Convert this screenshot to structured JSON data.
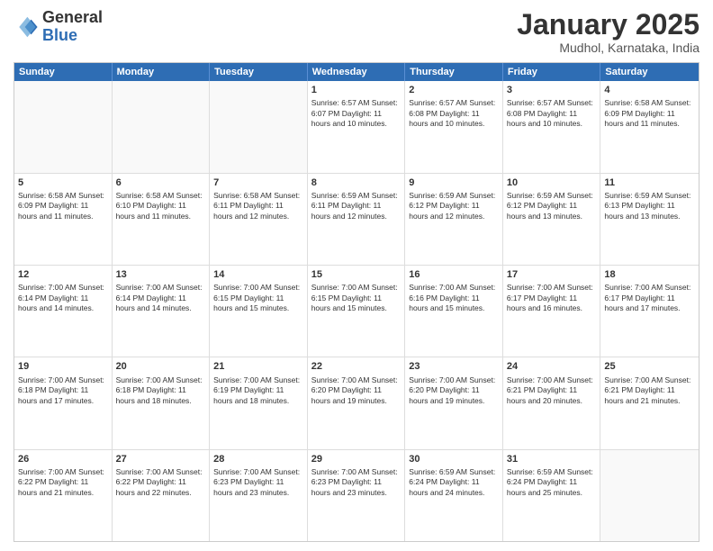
{
  "header": {
    "logo": {
      "general": "General",
      "blue": "Blue"
    },
    "title": "January 2025",
    "subtitle": "Mudhol, Karnataka, India"
  },
  "days_of_week": [
    "Sunday",
    "Monday",
    "Tuesday",
    "Wednesday",
    "Thursday",
    "Friday",
    "Saturday"
  ],
  "weeks": [
    [
      {
        "day": "",
        "info": ""
      },
      {
        "day": "",
        "info": ""
      },
      {
        "day": "",
        "info": ""
      },
      {
        "day": "1",
        "info": "Sunrise: 6:57 AM\nSunset: 6:07 PM\nDaylight: 11 hours\nand 10 minutes."
      },
      {
        "day": "2",
        "info": "Sunrise: 6:57 AM\nSunset: 6:08 PM\nDaylight: 11 hours\nand 10 minutes."
      },
      {
        "day": "3",
        "info": "Sunrise: 6:57 AM\nSunset: 6:08 PM\nDaylight: 11 hours\nand 10 minutes."
      },
      {
        "day": "4",
        "info": "Sunrise: 6:58 AM\nSunset: 6:09 PM\nDaylight: 11 hours\nand 11 minutes."
      }
    ],
    [
      {
        "day": "5",
        "info": "Sunrise: 6:58 AM\nSunset: 6:09 PM\nDaylight: 11 hours\nand 11 minutes."
      },
      {
        "day": "6",
        "info": "Sunrise: 6:58 AM\nSunset: 6:10 PM\nDaylight: 11 hours\nand 11 minutes."
      },
      {
        "day": "7",
        "info": "Sunrise: 6:58 AM\nSunset: 6:11 PM\nDaylight: 11 hours\nand 12 minutes."
      },
      {
        "day": "8",
        "info": "Sunrise: 6:59 AM\nSunset: 6:11 PM\nDaylight: 11 hours\nand 12 minutes."
      },
      {
        "day": "9",
        "info": "Sunrise: 6:59 AM\nSunset: 6:12 PM\nDaylight: 11 hours\nand 12 minutes."
      },
      {
        "day": "10",
        "info": "Sunrise: 6:59 AM\nSunset: 6:12 PM\nDaylight: 11 hours\nand 13 minutes."
      },
      {
        "day": "11",
        "info": "Sunrise: 6:59 AM\nSunset: 6:13 PM\nDaylight: 11 hours\nand 13 minutes."
      }
    ],
    [
      {
        "day": "12",
        "info": "Sunrise: 7:00 AM\nSunset: 6:14 PM\nDaylight: 11 hours\nand 14 minutes."
      },
      {
        "day": "13",
        "info": "Sunrise: 7:00 AM\nSunset: 6:14 PM\nDaylight: 11 hours\nand 14 minutes."
      },
      {
        "day": "14",
        "info": "Sunrise: 7:00 AM\nSunset: 6:15 PM\nDaylight: 11 hours\nand 15 minutes."
      },
      {
        "day": "15",
        "info": "Sunrise: 7:00 AM\nSunset: 6:15 PM\nDaylight: 11 hours\nand 15 minutes."
      },
      {
        "day": "16",
        "info": "Sunrise: 7:00 AM\nSunset: 6:16 PM\nDaylight: 11 hours\nand 15 minutes."
      },
      {
        "day": "17",
        "info": "Sunrise: 7:00 AM\nSunset: 6:17 PM\nDaylight: 11 hours\nand 16 minutes."
      },
      {
        "day": "18",
        "info": "Sunrise: 7:00 AM\nSunset: 6:17 PM\nDaylight: 11 hours\nand 17 minutes."
      }
    ],
    [
      {
        "day": "19",
        "info": "Sunrise: 7:00 AM\nSunset: 6:18 PM\nDaylight: 11 hours\nand 17 minutes."
      },
      {
        "day": "20",
        "info": "Sunrise: 7:00 AM\nSunset: 6:18 PM\nDaylight: 11 hours\nand 18 minutes."
      },
      {
        "day": "21",
        "info": "Sunrise: 7:00 AM\nSunset: 6:19 PM\nDaylight: 11 hours\nand 18 minutes."
      },
      {
        "day": "22",
        "info": "Sunrise: 7:00 AM\nSunset: 6:20 PM\nDaylight: 11 hours\nand 19 minutes."
      },
      {
        "day": "23",
        "info": "Sunrise: 7:00 AM\nSunset: 6:20 PM\nDaylight: 11 hours\nand 19 minutes."
      },
      {
        "day": "24",
        "info": "Sunrise: 7:00 AM\nSunset: 6:21 PM\nDaylight: 11 hours\nand 20 minutes."
      },
      {
        "day": "25",
        "info": "Sunrise: 7:00 AM\nSunset: 6:21 PM\nDaylight: 11 hours\nand 21 minutes."
      }
    ],
    [
      {
        "day": "26",
        "info": "Sunrise: 7:00 AM\nSunset: 6:22 PM\nDaylight: 11 hours\nand 21 minutes."
      },
      {
        "day": "27",
        "info": "Sunrise: 7:00 AM\nSunset: 6:22 PM\nDaylight: 11 hours\nand 22 minutes."
      },
      {
        "day": "28",
        "info": "Sunrise: 7:00 AM\nSunset: 6:23 PM\nDaylight: 11 hours\nand 23 minutes."
      },
      {
        "day": "29",
        "info": "Sunrise: 7:00 AM\nSunset: 6:23 PM\nDaylight: 11 hours\nand 23 minutes."
      },
      {
        "day": "30",
        "info": "Sunrise: 6:59 AM\nSunset: 6:24 PM\nDaylight: 11 hours\nand 24 minutes."
      },
      {
        "day": "31",
        "info": "Sunrise: 6:59 AM\nSunset: 6:24 PM\nDaylight: 11 hours\nand 25 minutes."
      },
      {
        "day": "",
        "info": ""
      }
    ]
  ]
}
